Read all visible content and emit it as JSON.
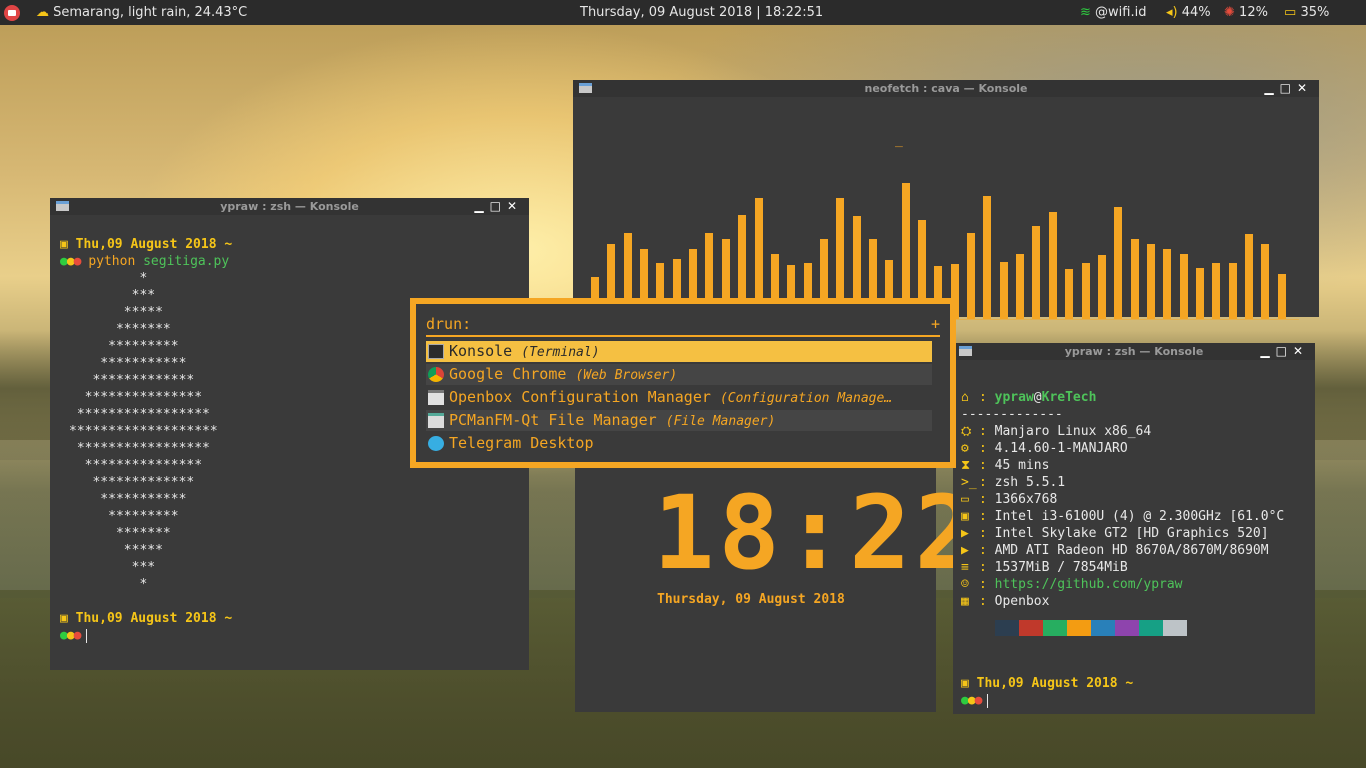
{
  "topbar": {
    "weather": "Semarang, light rain, 24.43°C",
    "datetime": "Thursday, 09 August 2018 | 18:22:51",
    "wifi": "@wifi.id",
    "volume": "44%",
    "cpu": "12%",
    "battery": "35%"
  },
  "term_left": {
    "title": "ypraw : zsh — Konsole",
    "date": "Thu,09 August 2018",
    "tilde": "~",
    "cmd": "python",
    "arg": "segitiga.py",
    "pattern": [
      "         *",
      "        ***",
      "       *****",
      "      *******",
      "     *********",
      "    ***********",
      "   *************",
      "  ***************",
      " *****************",
      "*******************",
      " *****************",
      "  ***************",
      "   *************",
      "    ***********",
      "     *********",
      "      *******",
      "       *****",
      "        ***",
      "         *"
    ]
  },
  "cava": {
    "title": "neofetch : cava — Konsole",
    "peak_marker": "_",
    "color": "#f5a623",
    "levels": [
      42,
      75,
      86,
      70,
      56,
      60,
      70,
      86,
      80,
      104,
      121,
      65,
      54,
      56,
      80,
      121,
      103,
      80,
      59,
      136,
      99,
      53,
      55,
      86,
      123,
      57,
      65,
      93,
      107,
      50,
      56,
      64,
      112,
      80,
      75,
      70,
      65,
      51,
      56,
      56,
      85,
      75,
      45
    ]
  },
  "clock": {
    "time": "18:22",
    "date": "Thursday, 09 August 2018"
  },
  "neofetch": {
    "title": "ypraw : zsh — Konsole",
    "user": "ypraw",
    "at": "@",
    "host": "KreTech",
    "divider": "-------------",
    "rows": [
      {
        "icon": "⛭",
        "value": "Manjaro Linux x86_64"
      },
      {
        "icon": "⚙",
        "value": "4.14.60-1-MANJARO"
      },
      {
        "icon": "⧗",
        "value": "45 mins"
      },
      {
        "icon": ">_",
        "value": "zsh 5.5.1"
      },
      {
        "icon": "▭",
        "value": "1366x768"
      },
      {
        "icon": "▣",
        "value": "Intel i3-6100U (4) @ 2.300GHz [61.0°C"
      },
      {
        "icon": "▶",
        "value": "Intel Skylake GT2 [HD Graphics 520]"
      },
      {
        "icon": "▶",
        "value": "AMD ATI Radeon HD 8670A/8670M/8690M"
      },
      {
        "icon": "≡",
        "value": "1537MiB / 7854MiB"
      },
      {
        "icon": "☺",
        "value": "https://github.com/ypraw",
        "link": true
      },
      {
        "icon": "▦",
        "value": "Openbox"
      }
    ],
    "swatches": [
      "#3a3a3a",
      "#2c3e50",
      "#c0392b",
      "#27ae60",
      "#f39c12",
      "#2980b9",
      "#8e44ad",
      "#16a085",
      "#bdc3c7"
    ],
    "date": "Thu,09 August 2018",
    "tilde": "~"
  },
  "rofi": {
    "prompt": "drun:",
    "plus": "+",
    "items": [
      {
        "name": "Konsole",
        "desc": "(Terminal)",
        "icon": "terminal-icon",
        "state": "selected"
      },
      {
        "name": "Google Chrome",
        "desc": "(Web Browser)",
        "icon": "chrome-icon",
        "state": "alt"
      },
      {
        "name": "Openbox Configuration Manager",
        "desc": "(Configuration Manage…",
        "icon": "window-config-icon",
        "state": "normal"
      },
      {
        "name": "PCManFM-Qt File Manager",
        "desc": "(File Manager)",
        "icon": "file-manager-icon",
        "state": "alt"
      },
      {
        "name": "Telegram Desktop",
        "desc": "",
        "icon": "telegram-icon",
        "state": "normal"
      }
    ]
  }
}
